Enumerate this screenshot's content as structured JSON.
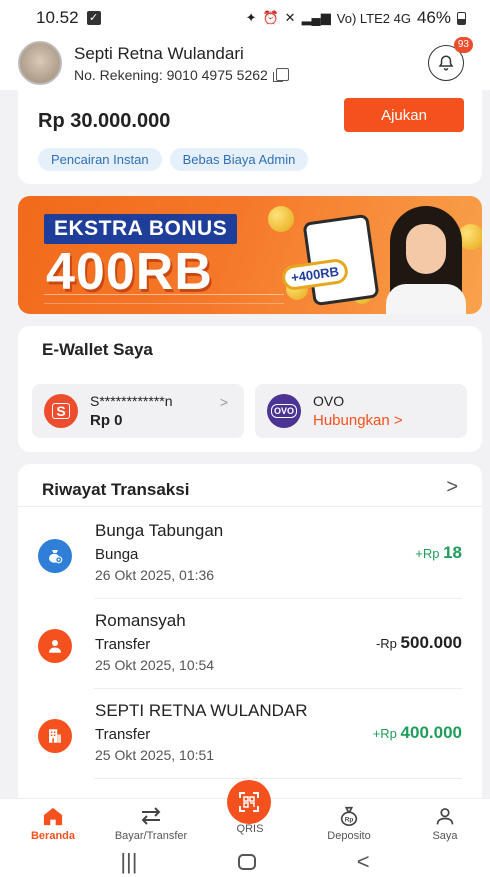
{
  "status_bar": {
    "time": "10.52",
    "signal_text": "Vo) LTE2 4G",
    "battery": "46%"
  },
  "header": {
    "name": "Septi Retna Wulandari",
    "account": "No. Rekening: 9010 4975 5262",
    "notification_count": "93"
  },
  "loan": {
    "amount": "Rp 30.000.000",
    "apply_label": "Ajukan",
    "chips": [
      "Pencairan Instan",
      "Bebas Biaya Admin"
    ]
  },
  "banner": {
    "tag": "EKSTRA BONUS",
    "big": "400RB",
    "badge": "+400RB"
  },
  "ewallet": {
    "title": "E-Wallet Saya",
    "items": [
      {
        "name": "S************n",
        "value": "Rp 0",
        "arrow": ">"
      },
      {
        "name": "OVO",
        "value": "Hubungkan >"
      }
    ]
  },
  "transactions": {
    "title": "Riwayat Transaksi",
    "arrow": ">",
    "rows": [
      {
        "name": "Bunga Tabungan",
        "type": "Bunga",
        "date": "26 Okt 2025, 01:36",
        "prefix": "+Rp",
        "amount": "18"
      },
      {
        "name": "Romansyah",
        "type": "Transfer",
        "date": "25 Okt 2025, 10:54",
        "prefix": "-Rp",
        "amount": "500.000"
      },
      {
        "name": "SEPTI RETNA WULANDAR",
        "type": "Transfer",
        "date": "25 Okt 2025, 10:51",
        "prefix": "+Rp",
        "amount": "400.000"
      }
    ]
  },
  "nav": {
    "items": [
      "Beranda",
      "Bayar/Transfer",
      "QRIS",
      "Deposito",
      "Saya"
    ]
  },
  "colors": {
    "accent": "#f4511e",
    "positive": "#1e9e5a",
    "link_blue": "#2f6fb8"
  }
}
